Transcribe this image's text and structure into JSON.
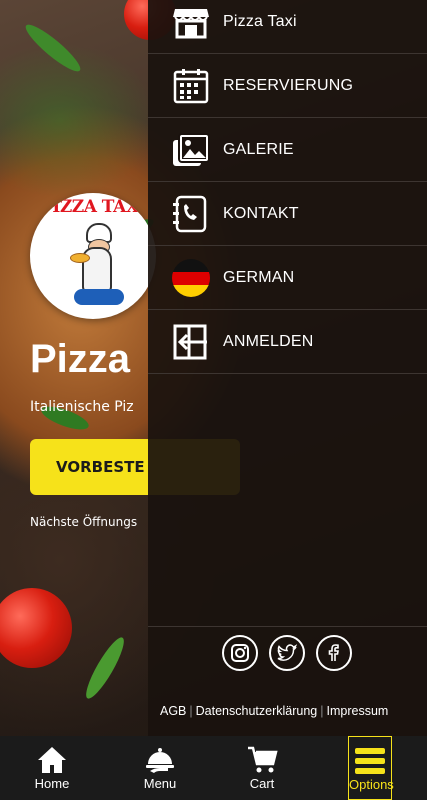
{
  "background": {
    "logo_text": "PIZZA TAXI",
    "title": "Pizza",
    "subtitle": "Italienische Piz",
    "order_button": "VORBESTE",
    "hours_text": "Nächste Öffnungs"
  },
  "drawer": {
    "items": [
      {
        "label": "Pizza Taxi",
        "icon": "store-icon"
      },
      {
        "label": "RESERVIERUNG",
        "icon": "calendar-icon"
      },
      {
        "label": "GALERIE",
        "icon": "gallery-icon"
      },
      {
        "label": "KONTAKT",
        "icon": "contact-book-icon"
      },
      {
        "label": "GERMAN",
        "icon": "german-flag-icon"
      },
      {
        "label": "ANMELDEN",
        "icon": "login-icon"
      }
    ],
    "social": [
      "instagram-icon",
      "twitter-icon",
      "facebook-icon"
    ],
    "legal": {
      "agb": "AGB",
      "privacy": "Datenschutzerklärung",
      "imprint": "Impressum"
    }
  },
  "bottom_nav": {
    "items": [
      {
        "label": "Home",
        "icon": "home-icon"
      },
      {
        "label": "Menu",
        "icon": "cloche-icon"
      },
      {
        "label": "Cart",
        "icon": "cart-icon"
      },
      {
        "label": "Options",
        "icon": "hamburger-icon",
        "active": true
      }
    ]
  },
  "colors": {
    "accent": "#f6e21a",
    "drawer_bg": "#1a120e",
    "nav_bg": "#1b1b1b"
  }
}
